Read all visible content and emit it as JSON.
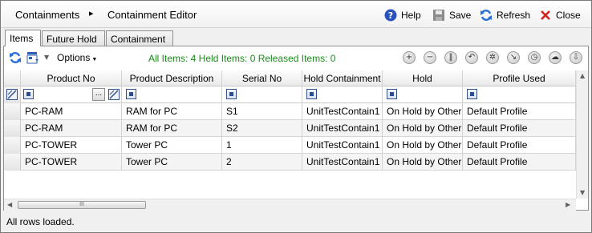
{
  "header": {
    "breadcrumb_root": "Containments",
    "breadcrumb_separator": "▸",
    "breadcrumb_current": "Containment Editor",
    "help_label": "Help",
    "save_label": "Save",
    "refresh_label": "Refresh",
    "close_label": "Close"
  },
  "tabs": [
    "Items",
    "Future Hold",
    "Containment"
  ],
  "toolbar": {
    "options_label": "Options",
    "summary": "All Items: 4 Held Items: 0 Released Items: 0",
    "action_icons": [
      "add-icon",
      "remove-icon",
      "pause-icon",
      "undo-icon",
      "settings-icon",
      "export-icon",
      "clock-icon",
      "cloud-icon",
      "download-icon"
    ]
  },
  "grid": {
    "columns": [
      "Product No",
      "Product Description",
      "Serial No",
      "Hold Containment",
      "Hold",
      "Profile Used"
    ],
    "filter_ellipsis": "...",
    "rows": [
      [
        "PC-RAM",
        "RAM for PC",
        "S1",
        "UnitTestContain1",
        "On Hold by Other",
        "Default Profile"
      ],
      [
        "PC-RAM",
        "RAM for PC",
        "S2",
        "UnitTestContain1",
        "On Hold by Other",
        "Default Profile"
      ],
      [
        "PC-TOWER",
        "Tower PC",
        "1",
        "UnitTestContain1",
        "On Hold by Other",
        "Default Profile"
      ],
      [
        "PC-TOWER",
        "Tower PC",
        "2",
        "UnitTestContain1",
        "On Hold by Other",
        "Default Profile"
      ]
    ],
    "hscroll_thumb_label": "III"
  },
  "status": "All rows loaded."
}
